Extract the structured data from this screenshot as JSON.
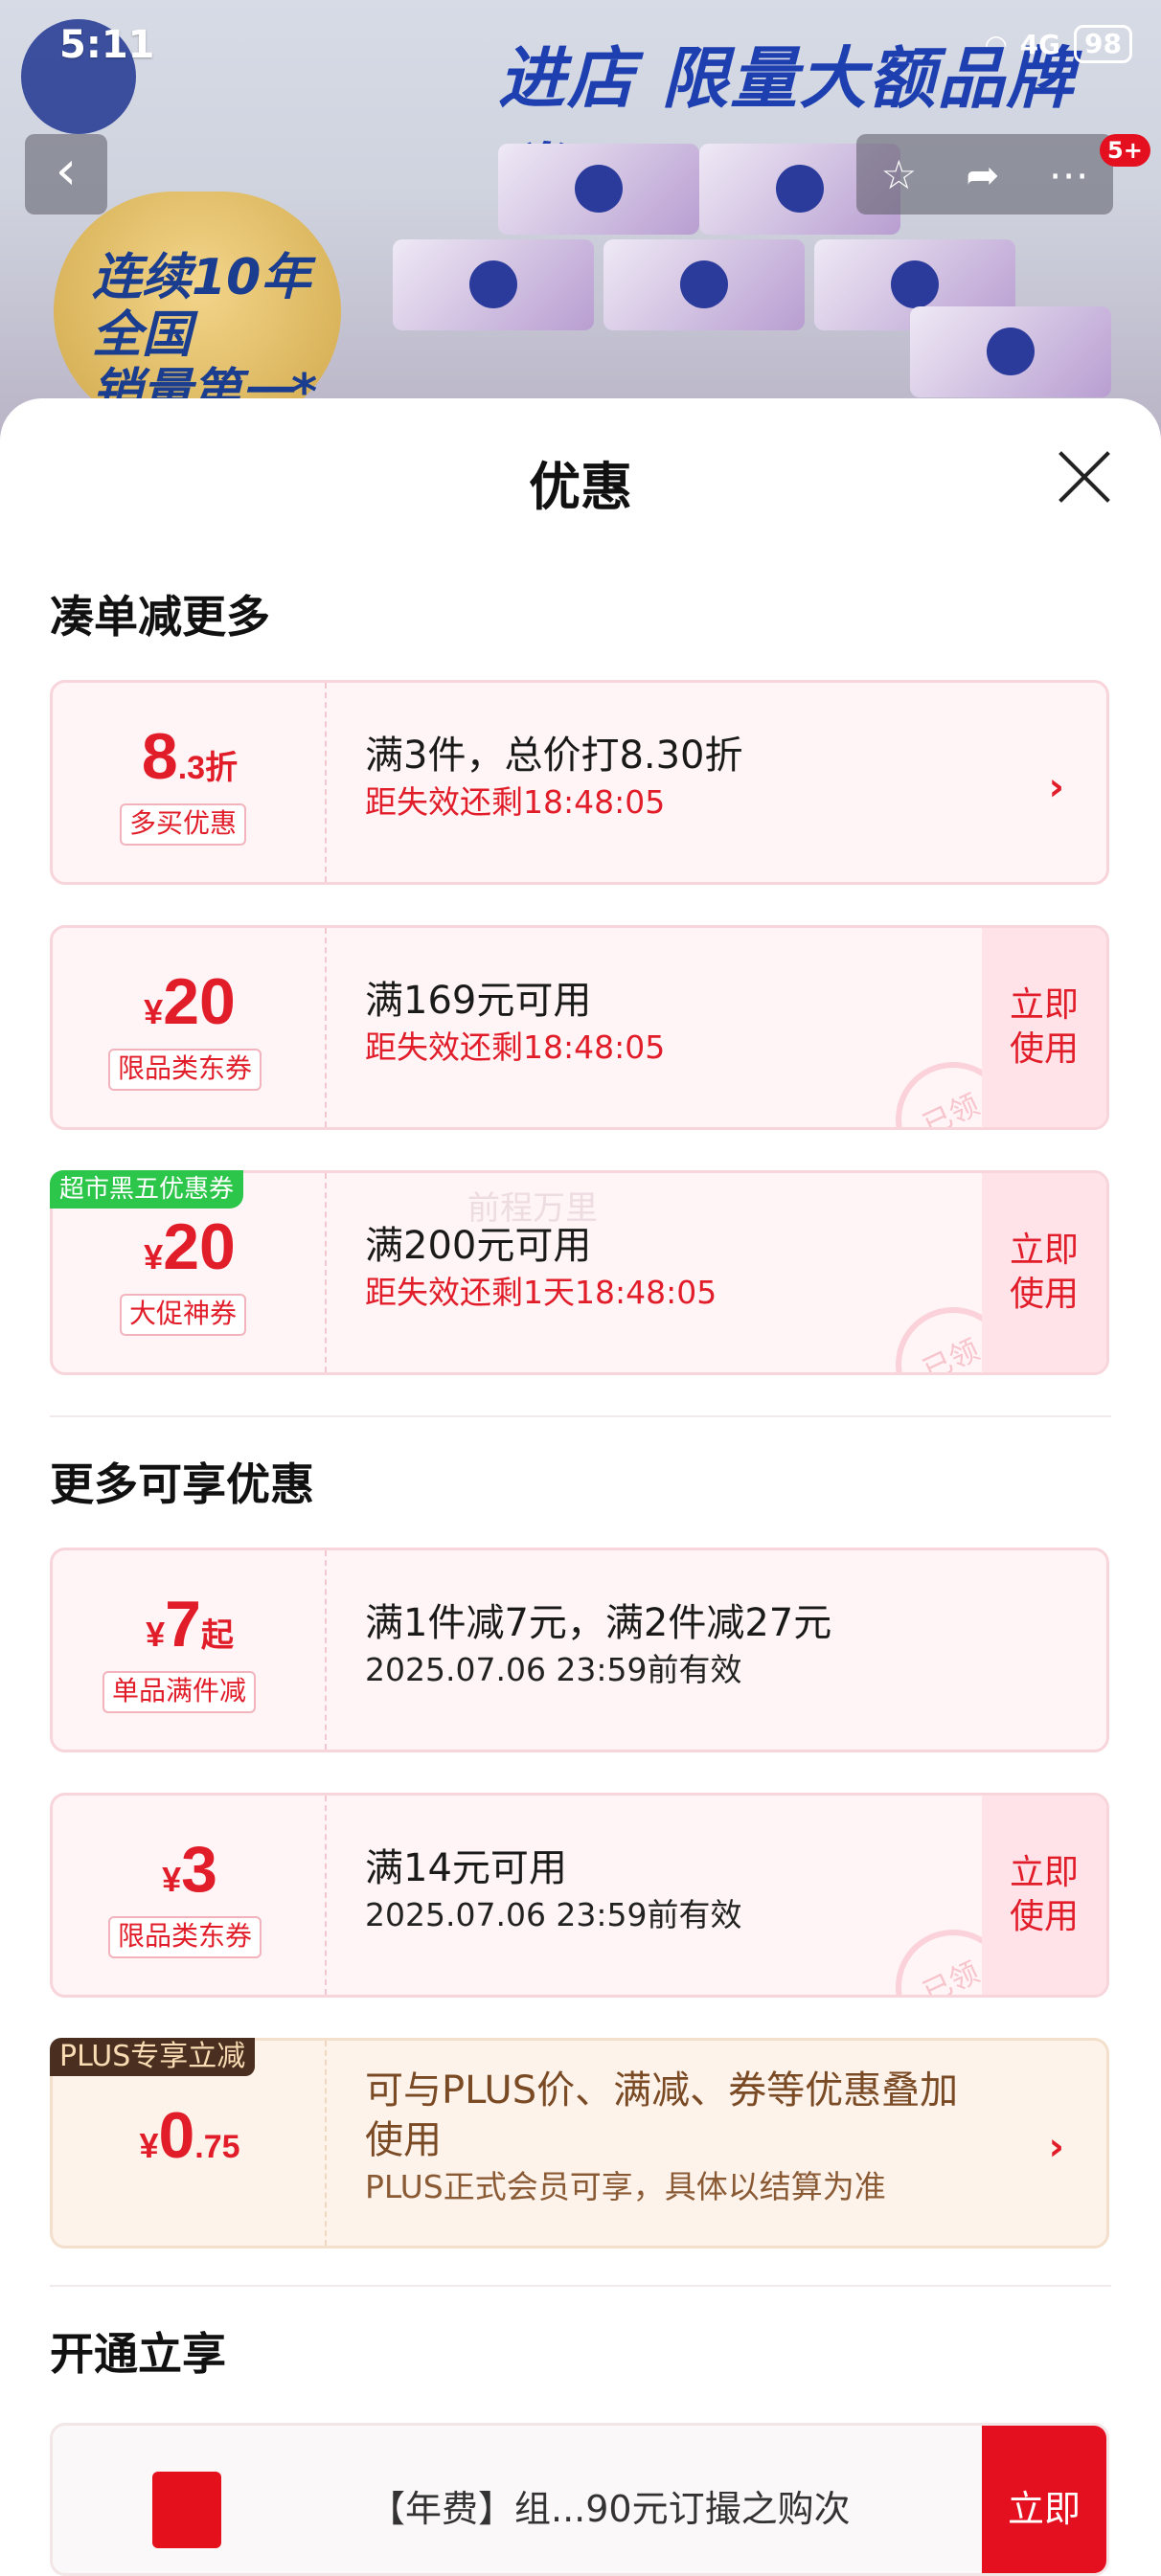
{
  "status_bar": {
    "time": "5:11",
    "battery": "98",
    "signal": "4G"
  },
  "banner": {
    "slogan": "进店 限量大额品牌券!",
    "badge_line1": "连续10年",
    "badge_line2": "全国",
    "badge_line3": "销量第一*",
    "cart_count": "5+"
  },
  "sheet": {
    "title": "优惠"
  },
  "sections": {
    "more_discount": "凑单减更多",
    "more_offers": "更多可享优惠",
    "open_enjoy": "开通立享"
  },
  "coupons": [
    {
      "amount_big": "8",
      "amount_small": ".3折",
      "tag": "多买优惠",
      "line1": "满3件，总价打8.30折",
      "line2": "距失效还剩18:48:05"
    },
    {
      "currency": "¥",
      "amount_big": "20",
      "tag": "限品类东券",
      "line1": "满169元可用",
      "line2": "距失效还剩18:48:05",
      "action": [
        "立即",
        "使用"
      ],
      "stamp": "已领"
    },
    {
      "corner": "超市黑五优惠券",
      "currency": "¥",
      "amount_big": "20",
      "tag": "大促神券",
      "line1": "满200元可用",
      "line2": "距失效还剩1天18:48:05",
      "action": [
        "立即",
        "使用"
      ],
      "stamp": "已领"
    },
    {
      "currency": "¥",
      "amount_big": "7",
      "amount_small": "起",
      "tag": "单品满件减",
      "line1": "满1件减7元，满2件减27元",
      "line2": "2025.07.06 23:59前有效"
    },
    {
      "currency": "¥",
      "amount_big": "3",
      "tag": "限品类东券",
      "line1": "满14元可用",
      "line2": "2025.07.06 23:59前有效",
      "action": [
        "立即",
        "使用"
      ],
      "stamp": "已领"
    },
    {
      "corner": "PLUS专享立减",
      "currency": "¥",
      "amount_big": "0",
      "amount_small": ".75",
      "line1a": "可与PLUS价、满减、券等优惠叠加",
      "line1b": "使用",
      "line2": "PLUS正式会员可享，具体以结算为准"
    }
  ],
  "watermark": "前程万里",
  "bottom_card": {
    "text": "【年费】组...90元订撮之购次",
    "action": "立即"
  },
  "colors": {
    "accent_red": "#e11d2a",
    "plus_brown": "#4a2f20",
    "green_tag": "#2cc64a"
  }
}
